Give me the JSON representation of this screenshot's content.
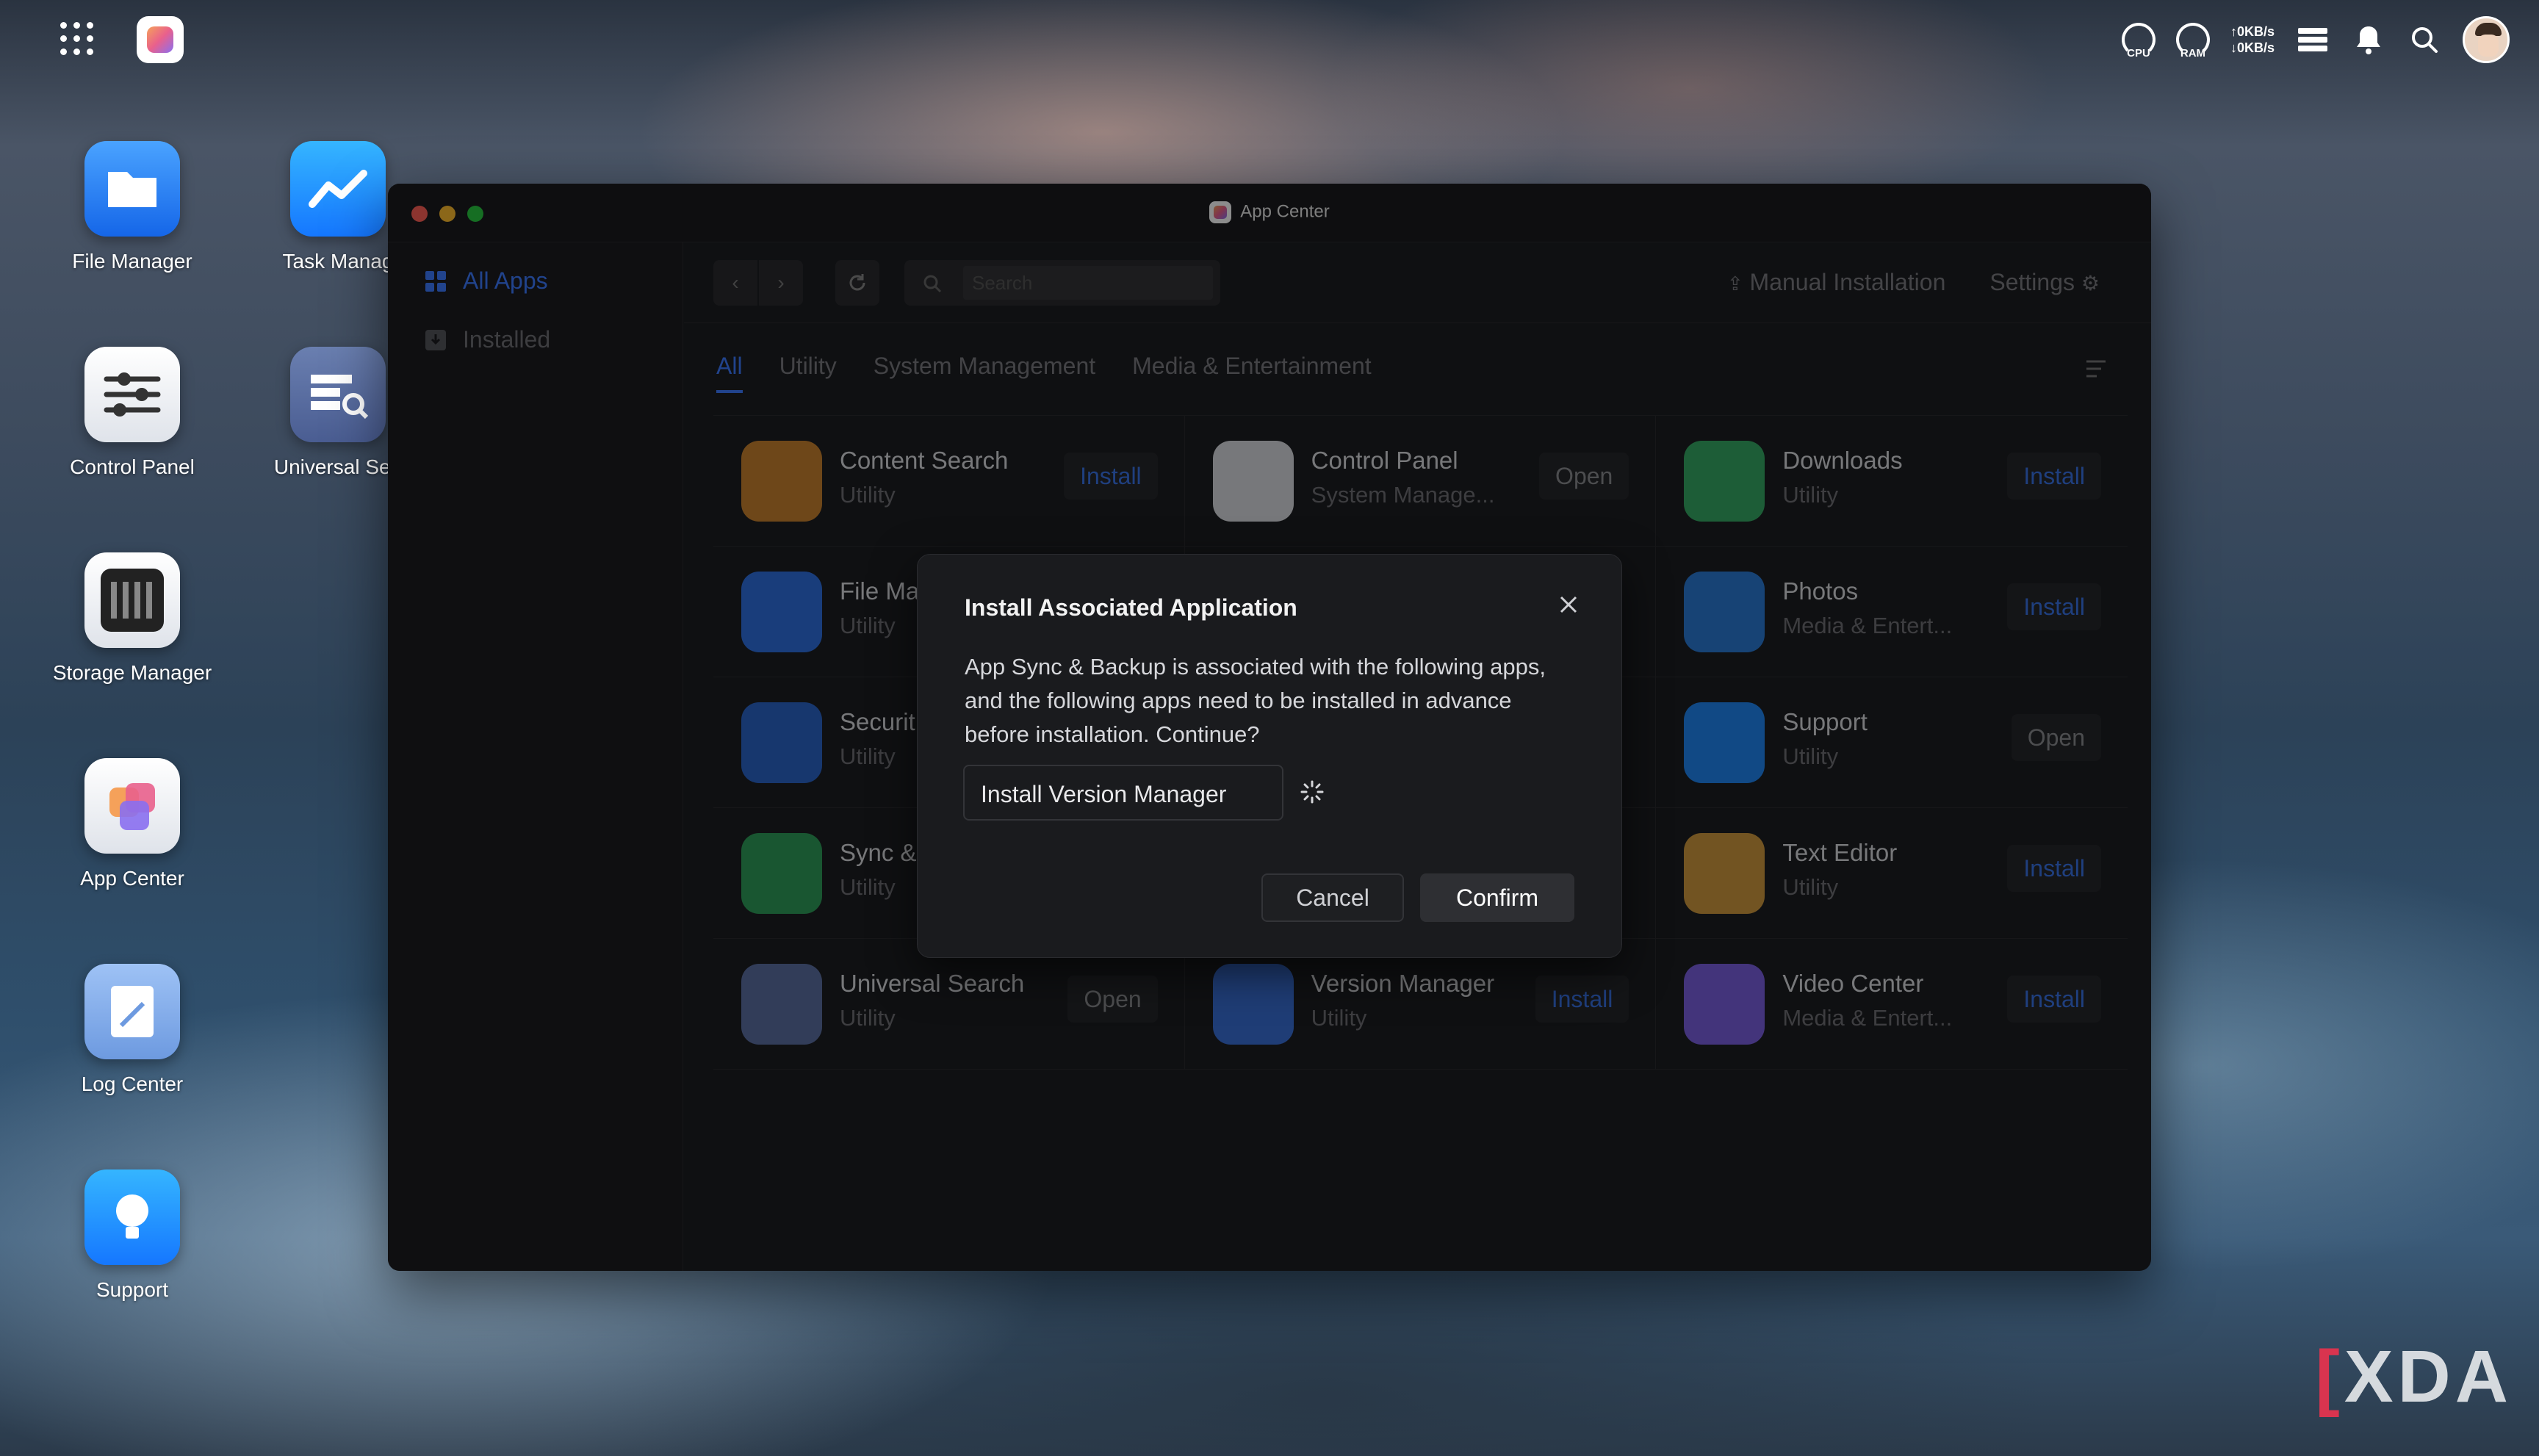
{
  "topbar": {
    "cpu_label": "CPU",
    "ram_label": "RAM",
    "net_up": "↑0KB/s",
    "net_down": "↓0KB/s"
  },
  "desktop": {
    "icons": [
      {
        "label": "File Manager",
        "icon": "folder-icon"
      },
      {
        "label": "Task Manag",
        "icon": "task-manager-icon"
      },
      {
        "label": "Control Panel",
        "icon": "control-panel-icon"
      },
      {
        "label": "Universal Sea",
        "icon": "universal-search-icon"
      },
      {
        "label": "Storage Manager",
        "icon": "storage-manager-icon"
      },
      {
        "label": "App Center",
        "icon": "app-center-icon"
      },
      {
        "label": "Log Center",
        "icon": "log-center-icon"
      },
      {
        "label": "Support",
        "icon": "support-icon"
      }
    ]
  },
  "window": {
    "title": "App Center",
    "sidebar": {
      "items": [
        {
          "label": "All Apps",
          "active": true
        },
        {
          "label": "Installed",
          "active": false
        }
      ]
    },
    "toolbar": {
      "search_placeholder": "Search",
      "manual_installation": "Manual Installation",
      "settings": "Settings"
    },
    "tabs": [
      {
        "label": "All",
        "active": true
      },
      {
        "label": "Utility"
      },
      {
        "label": "System Management"
      },
      {
        "label": "Media & Entertainment"
      }
    ],
    "apps": [
      {
        "name": "Content Search",
        "category": "Utility",
        "action": "Install",
        "color": "#c9822e"
      },
      {
        "name": "Control Panel",
        "category": "System Manage...",
        "action": "Open",
        "color": "#d9dbe0"
      },
      {
        "name": "Downloads",
        "category": "Utility",
        "action": "Install",
        "color": "#35a964"
      },
      {
        "name": "File Ma",
        "category": "Utility",
        "action": "",
        "color": "#2f6fe0"
      },
      {
        "name": "",
        "category": "",
        "action": "",
        "color": ""
      },
      {
        "name": "Photos",
        "category": "Media & Entert...",
        "action": "Install",
        "color": "#2a7bd6"
      },
      {
        "name": "Securit",
        "category": "Utility",
        "action": "",
        "color": "#2a64c8"
      },
      {
        "name": "",
        "category": "",
        "action": "",
        "color": ""
      },
      {
        "name": "Support",
        "category": "Utility",
        "action": "Open",
        "color": "#1f86f2"
      },
      {
        "name": "Sync &",
        "category": "Utility",
        "action": "",
        "color": "#2f9d5a"
      },
      {
        "name": "",
        "category": "",
        "action": "",
        "color": ""
      },
      {
        "name": "Text Editor",
        "category": "Utility",
        "action": "Install",
        "color": "#cf9a3e"
      },
      {
        "name": "Universal Search",
        "category": "Utility",
        "action": "Open",
        "color": "#5b6fa3"
      },
      {
        "name": "Version Manager",
        "category": "Utility",
        "action": "Install",
        "color": "#3a6fd8"
      },
      {
        "name": "Video Center",
        "category": "Media & Entert...",
        "action": "Install",
        "color": "#7a5fe0"
      }
    ]
  },
  "dialog": {
    "title": "Install Associated Application",
    "body": "App Sync & Backup is associated with the following apps, and the following apps need to be installed in advance before installation. Continue?",
    "dependency": "Install Version Manager",
    "cancel": "Cancel",
    "confirm": "Confirm"
  },
  "watermark": "XDA"
}
